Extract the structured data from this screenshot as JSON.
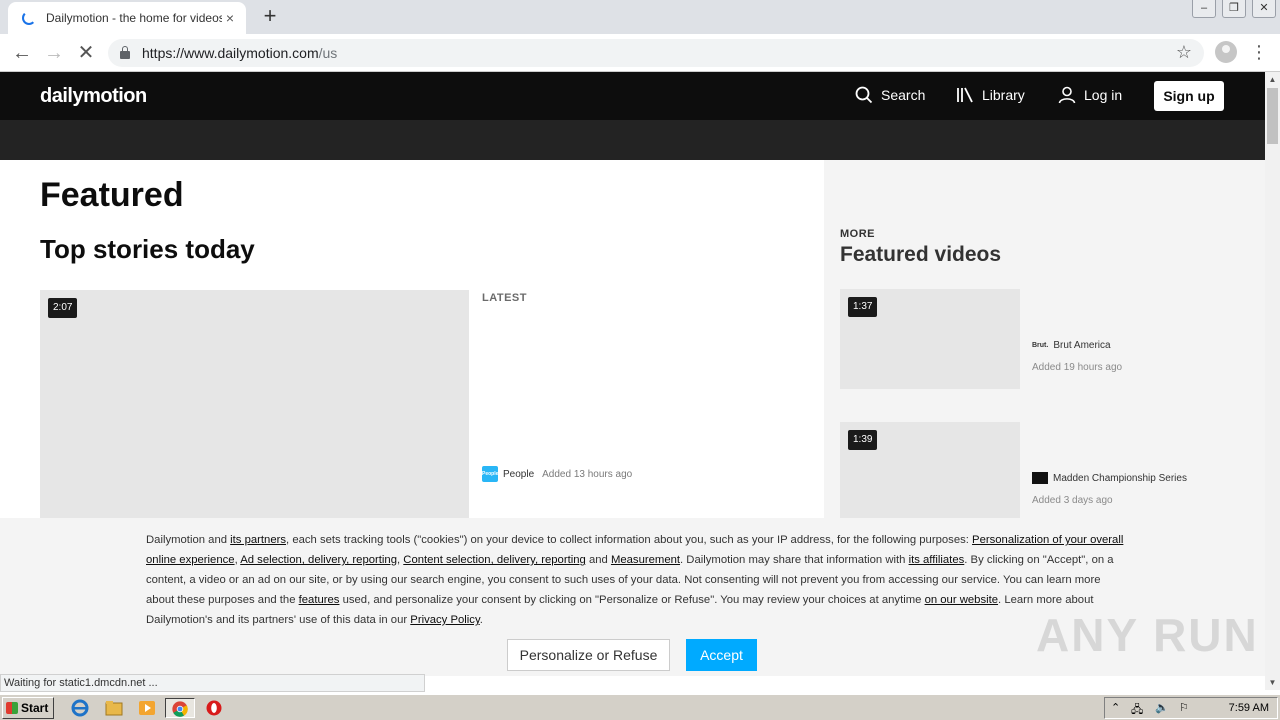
{
  "browser": {
    "tab_title": "Dailymotion - the home for videos th",
    "tab_close": "×",
    "new_tab": "+",
    "url_host": "https://www.dailymotion.com",
    "url_path": "/us",
    "status_text": "Waiting for static1.dmcdn.net ..."
  },
  "header": {
    "logo": "dailymotion",
    "search_label": "Search",
    "library_label": "Library",
    "login_label": "Log in",
    "signup_label": "Sign up"
  },
  "main": {
    "featured_heading": "Featured",
    "top_stories_heading": "Top stories today",
    "top_video": {
      "duration": "2:07"
    },
    "latest_label": "LATEST",
    "latest_item": {
      "channel": "People",
      "channel_logo_text": "People",
      "added": "Added 13 hours ago"
    }
  },
  "aside": {
    "more_label": "MORE",
    "heading": "Featured videos",
    "videos": [
      {
        "duration": "1:37",
        "channel": "Brut America",
        "channel_logo_text": "Brut.",
        "added": "Added 19 hours ago"
      },
      {
        "duration": "1:39",
        "channel": "Madden Championship Series",
        "channel_logo_text": "",
        "added": "Added 3 days ago"
      }
    ]
  },
  "consent": {
    "t1": "Dailymotion and ",
    "l_partners": "its partners",
    "t2": ", each sets tracking tools (\"cookies\") on your device to collect information about you, such as your IP address, for the following purposes: ",
    "l_personalization": "Personalization of your overall online experience",
    "t3": ", ",
    "l_ads": "Ad selection, delivery, reporting",
    "t4": ", ",
    "l_content": "Content selection, delivery, reporting",
    "t5": " and ",
    "l_measurement": "Measurement",
    "t6": ". Dailymotion may share that information with ",
    "l_affiliates": "its affiliates",
    "t7": ". By clicking on \"Accept\", on a content, a video or an ad on our site, or by using our search engine, you consent to such uses of your data. Not consenting will not prevent you from accessing our service. You can learn more about these purposes and the ",
    "l_features": "features",
    "t8": " used, and personalize your consent by clicking on \"Personalize or Refuse\". You may review your choices at anytime ",
    "l_website": "on our website",
    "t9": ". Learn more about Dailymotion's and its partners' use of this data in our ",
    "l_privacy": "Privacy Policy",
    "t10": ".",
    "refuse_label": "Personalize or Refuse",
    "accept_label": "Accept"
  },
  "watermark": "ANY RUN",
  "taskbar": {
    "start_label": "Start",
    "clock": "7:59 AM"
  },
  "colors": {
    "accent": "#00aaff",
    "header_bg": "#0d0d0d",
    "subbar_bg": "#232323"
  }
}
